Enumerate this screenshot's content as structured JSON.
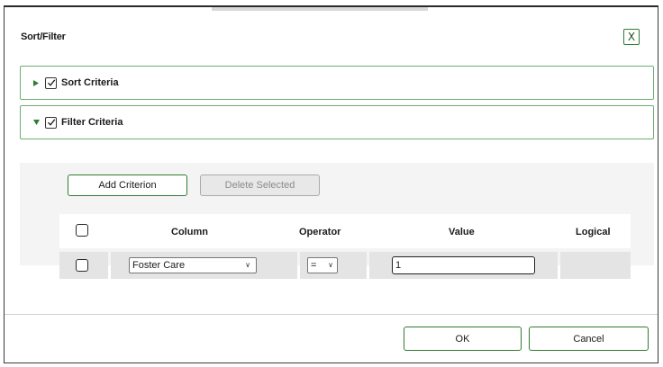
{
  "dialog": {
    "title": "Sort/Filter",
    "close_label": "X"
  },
  "sections": {
    "sort": {
      "label": "Sort Criteria",
      "expanded": false,
      "checked": true
    },
    "filter": {
      "label": "Filter Criteria",
      "expanded": true,
      "checked": true
    }
  },
  "filter": {
    "add_label": "Add Criterion",
    "delete_label": "Delete Selected",
    "headers": {
      "column": "Column",
      "operator": "Operator",
      "value": "Value",
      "logical": "Logical"
    },
    "rows": [
      {
        "checked": false,
        "column": "Foster Care",
        "operator": "=",
        "value": "1",
        "logical": ""
      }
    ]
  },
  "footer": {
    "ok_label": "OK",
    "cancel_label": "Cancel"
  },
  "colors": {
    "accent": "#2e7d32",
    "section_border": "#6fae73",
    "panel_bg": "#f4f4f4",
    "cell_bg": "#e4e4e4"
  },
  "icons": {
    "close": "close-icon",
    "collapsed": "triangle-right-icon",
    "expanded": "triangle-down-icon",
    "check": "check-icon",
    "dropdown": "chevron-down-icon"
  }
}
